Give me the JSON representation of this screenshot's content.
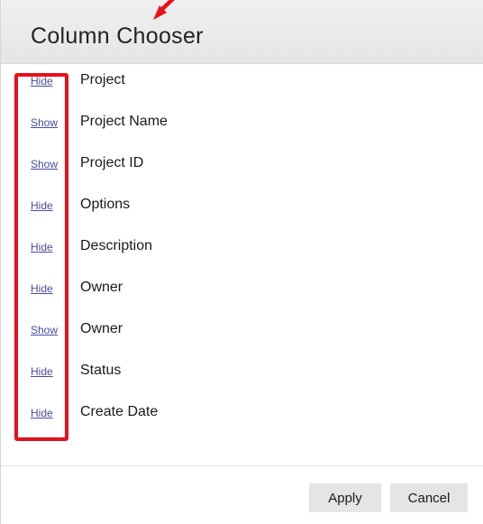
{
  "dialog": {
    "title": "Column Chooser"
  },
  "columns": [
    {
      "toggle": "Hide",
      "label": "Project"
    },
    {
      "toggle": "Show",
      "label": "Project Name"
    },
    {
      "toggle": "Show",
      "label": "Project ID"
    },
    {
      "toggle": "Hide",
      "label": "Options"
    },
    {
      "toggle": "Hide",
      "label": "Description"
    },
    {
      "toggle": "Hide",
      "label": "Owner"
    },
    {
      "toggle": "Show",
      "label": "Owner"
    },
    {
      "toggle": "Hide",
      "label": "Status"
    },
    {
      "toggle": "Hide",
      "label": "Create Date"
    }
  ],
  "footer": {
    "apply_label": "Apply",
    "cancel_label": "Cancel"
  },
  "colors": {
    "annotation": "#e8101a",
    "link": "#4a4aa0",
    "header_bg": "#ececec",
    "button_bg": "#e5e5e5"
  }
}
